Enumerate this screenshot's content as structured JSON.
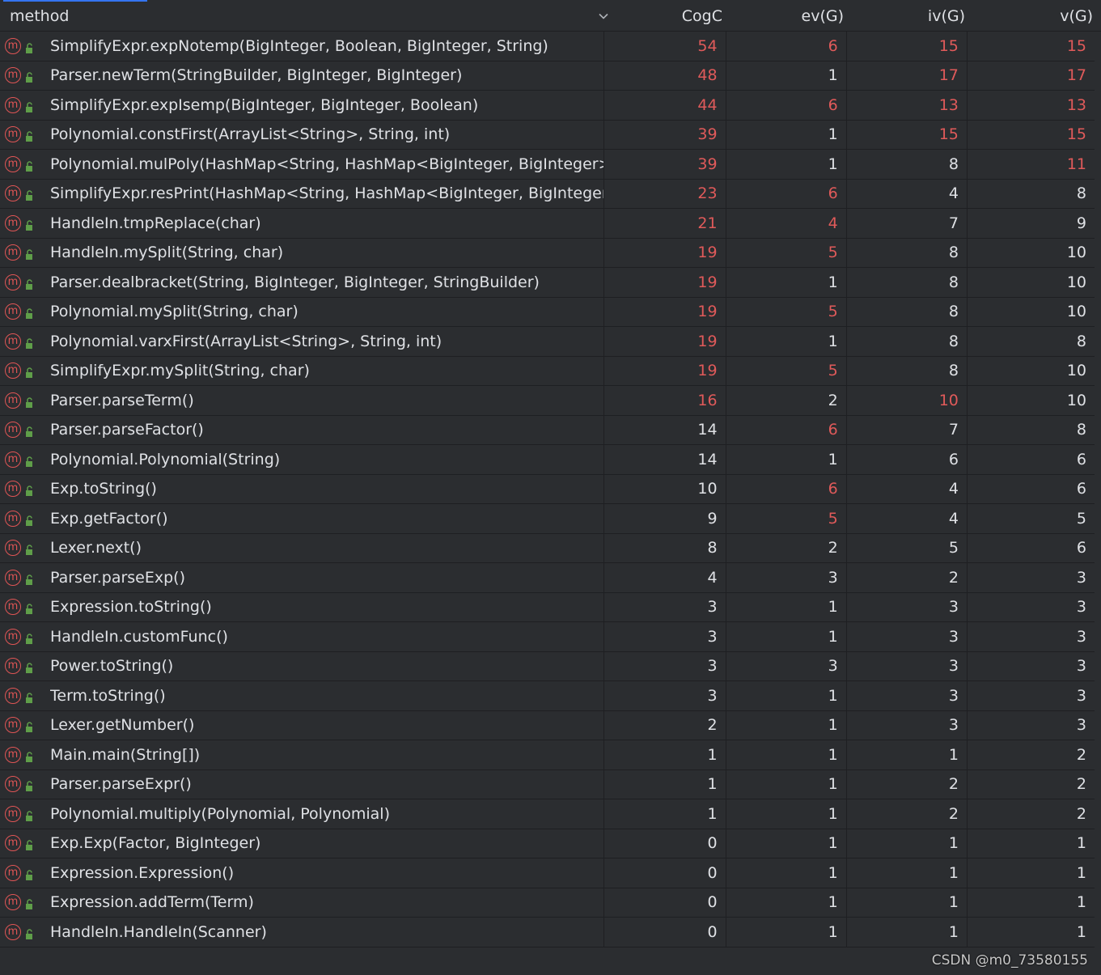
{
  "header": {
    "method": "method",
    "cogc": "CogC",
    "ev": "ev(G)",
    "iv": "iv(G)",
    "v": "v(G)"
  },
  "colors": {
    "accent": "#3574f0",
    "warn": "#e05a5a",
    "text": "#dfe1e5",
    "bg": "#2b2d30",
    "lock": "#5f9e49"
  },
  "icons": {
    "method": "method-m-icon",
    "visibility": "public-lock-icon",
    "sort": "chevron-down-icon"
  },
  "rows": [
    {
      "method": "SimplifyExpr.expNotemp(BigInteger, Boolean, BigInteger, String)",
      "cogc": "54",
      "ev": "6",
      "iv": "15",
      "v": "15",
      "hc": 1,
      "he": 1,
      "hi": 1,
      "hv": 1
    },
    {
      "method": "Parser.newTerm(StringBuilder, BigInteger, BigInteger)",
      "cogc": "48",
      "ev": "1",
      "iv": "17",
      "v": "17",
      "hc": 1,
      "he": 0,
      "hi": 1,
      "hv": 1
    },
    {
      "method": "SimplifyExpr.expIsemp(BigInteger, BigInteger, Boolean)",
      "cogc": "44",
      "ev": "6",
      "iv": "13",
      "v": "13",
      "hc": 1,
      "he": 1,
      "hi": 1,
      "hv": 1
    },
    {
      "method": "Polynomial.constFirst(ArrayList<String>, String, int)",
      "cogc": "39",
      "ev": "1",
      "iv": "15",
      "v": "15",
      "hc": 1,
      "he": 0,
      "hi": 1,
      "hv": 1
    },
    {
      "method": "Polynomial.mulPoly(HashMap<String, HashMap<BigInteger, BigInteger>>, H",
      "cogc": "39",
      "ev": "1",
      "iv": "8",
      "v": "11",
      "hc": 1,
      "he": 0,
      "hi": 0,
      "hv": 1
    },
    {
      "method": "SimplifyExpr.resPrint(HashMap<String, HashMap<BigInteger, BigInteger>>)",
      "cogc": "23",
      "ev": "6",
      "iv": "4",
      "v": "8",
      "hc": 1,
      "he": 1,
      "hi": 0,
      "hv": 0
    },
    {
      "method": "HandleIn.tmpReplace(char)",
      "cogc": "21",
      "ev": "4",
      "iv": "7",
      "v": "9",
      "hc": 1,
      "he": 1,
      "hi": 0,
      "hv": 0
    },
    {
      "method": "HandleIn.mySplit(String, char)",
      "cogc": "19",
      "ev": "5",
      "iv": "8",
      "v": "10",
      "hc": 1,
      "he": 1,
      "hi": 0,
      "hv": 0
    },
    {
      "method": "Parser.dealbracket(String, BigInteger, BigInteger, StringBuilder)",
      "cogc": "19",
      "ev": "1",
      "iv": "8",
      "v": "10",
      "hc": 1,
      "he": 0,
      "hi": 0,
      "hv": 0
    },
    {
      "method": "Polynomial.mySplit(String, char)",
      "cogc": "19",
      "ev": "5",
      "iv": "8",
      "v": "10",
      "hc": 1,
      "he": 1,
      "hi": 0,
      "hv": 0
    },
    {
      "method": "Polynomial.varxFirst(ArrayList<String>, String, int)",
      "cogc": "19",
      "ev": "1",
      "iv": "8",
      "v": "8",
      "hc": 1,
      "he": 0,
      "hi": 0,
      "hv": 0
    },
    {
      "method": "SimplifyExpr.mySplit(String, char)",
      "cogc": "19",
      "ev": "5",
      "iv": "8",
      "v": "10",
      "hc": 1,
      "he": 1,
      "hi": 0,
      "hv": 0
    },
    {
      "method": "Parser.parseTerm()",
      "cogc": "16",
      "ev": "2",
      "iv": "10",
      "v": "10",
      "hc": 1,
      "he": 0,
      "hi": 1,
      "hv": 0
    },
    {
      "method": "Parser.parseFactor()",
      "cogc": "14",
      "ev": "6",
      "iv": "7",
      "v": "8",
      "hc": 0,
      "he": 1,
      "hi": 0,
      "hv": 0
    },
    {
      "method": "Polynomial.Polynomial(String)",
      "cogc": "14",
      "ev": "1",
      "iv": "6",
      "v": "6",
      "hc": 0,
      "he": 0,
      "hi": 0,
      "hv": 0
    },
    {
      "method": "Exp.toString()",
      "cogc": "10",
      "ev": "6",
      "iv": "4",
      "v": "6",
      "hc": 0,
      "he": 1,
      "hi": 0,
      "hv": 0
    },
    {
      "method": "Exp.getFactor()",
      "cogc": "9",
      "ev": "5",
      "iv": "4",
      "v": "5",
      "hc": 0,
      "he": 1,
      "hi": 0,
      "hv": 0
    },
    {
      "method": "Lexer.next()",
      "cogc": "8",
      "ev": "2",
      "iv": "5",
      "v": "6",
      "hc": 0,
      "he": 0,
      "hi": 0,
      "hv": 0
    },
    {
      "method": "Parser.parseExp()",
      "cogc": "4",
      "ev": "3",
      "iv": "2",
      "v": "3",
      "hc": 0,
      "he": 0,
      "hi": 0,
      "hv": 0
    },
    {
      "method": "Expression.toString()",
      "cogc": "3",
      "ev": "1",
      "iv": "3",
      "v": "3",
      "hc": 0,
      "he": 0,
      "hi": 0,
      "hv": 0
    },
    {
      "method": "HandleIn.customFunc()",
      "cogc": "3",
      "ev": "1",
      "iv": "3",
      "v": "3",
      "hc": 0,
      "he": 0,
      "hi": 0,
      "hv": 0
    },
    {
      "method": "Power.toString()",
      "cogc": "3",
      "ev": "3",
      "iv": "3",
      "v": "3",
      "hc": 0,
      "he": 0,
      "hi": 0,
      "hv": 0
    },
    {
      "method": "Term.toString()",
      "cogc": "3",
      "ev": "1",
      "iv": "3",
      "v": "3",
      "hc": 0,
      "he": 0,
      "hi": 0,
      "hv": 0
    },
    {
      "method": "Lexer.getNumber()",
      "cogc": "2",
      "ev": "1",
      "iv": "3",
      "v": "3",
      "hc": 0,
      "he": 0,
      "hi": 0,
      "hv": 0
    },
    {
      "method": "Main.main(String[])",
      "cogc": "1",
      "ev": "1",
      "iv": "1",
      "v": "2",
      "hc": 0,
      "he": 0,
      "hi": 0,
      "hv": 0
    },
    {
      "method": "Parser.parseExpr()",
      "cogc": "1",
      "ev": "1",
      "iv": "2",
      "v": "2",
      "hc": 0,
      "he": 0,
      "hi": 0,
      "hv": 0
    },
    {
      "method": "Polynomial.multiply(Polynomial, Polynomial)",
      "cogc": "1",
      "ev": "1",
      "iv": "2",
      "v": "2",
      "hc": 0,
      "he": 0,
      "hi": 0,
      "hv": 0
    },
    {
      "method": "Exp.Exp(Factor, BigInteger)",
      "cogc": "0",
      "ev": "1",
      "iv": "1",
      "v": "1",
      "hc": 0,
      "he": 0,
      "hi": 0,
      "hv": 0
    },
    {
      "method": "Expression.Expression()",
      "cogc": "0",
      "ev": "1",
      "iv": "1",
      "v": "1",
      "hc": 0,
      "he": 0,
      "hi": 0,
      "hv": 0
    },
    {
      "method": "Expression.addTerm(Term)",
      "cogc": "0",
      "ev": "1",
      "iv": "1",
      "v": "1",
      "hc": 0,
      "he": 0,
      "hi": 0,
      "hv": 0
    },
    {
      "method": "HandleIn.HandleIn(Scanner)",
      "cogc": "0",
      "ev": "1",
      "iv": "1",
      "v": "1",
      "hc": 0,
      "he": 0,
      "hi": 0,
      "hv": 0
    }
  ],
  "watermark": "CSDN @m0_73580155"
}
